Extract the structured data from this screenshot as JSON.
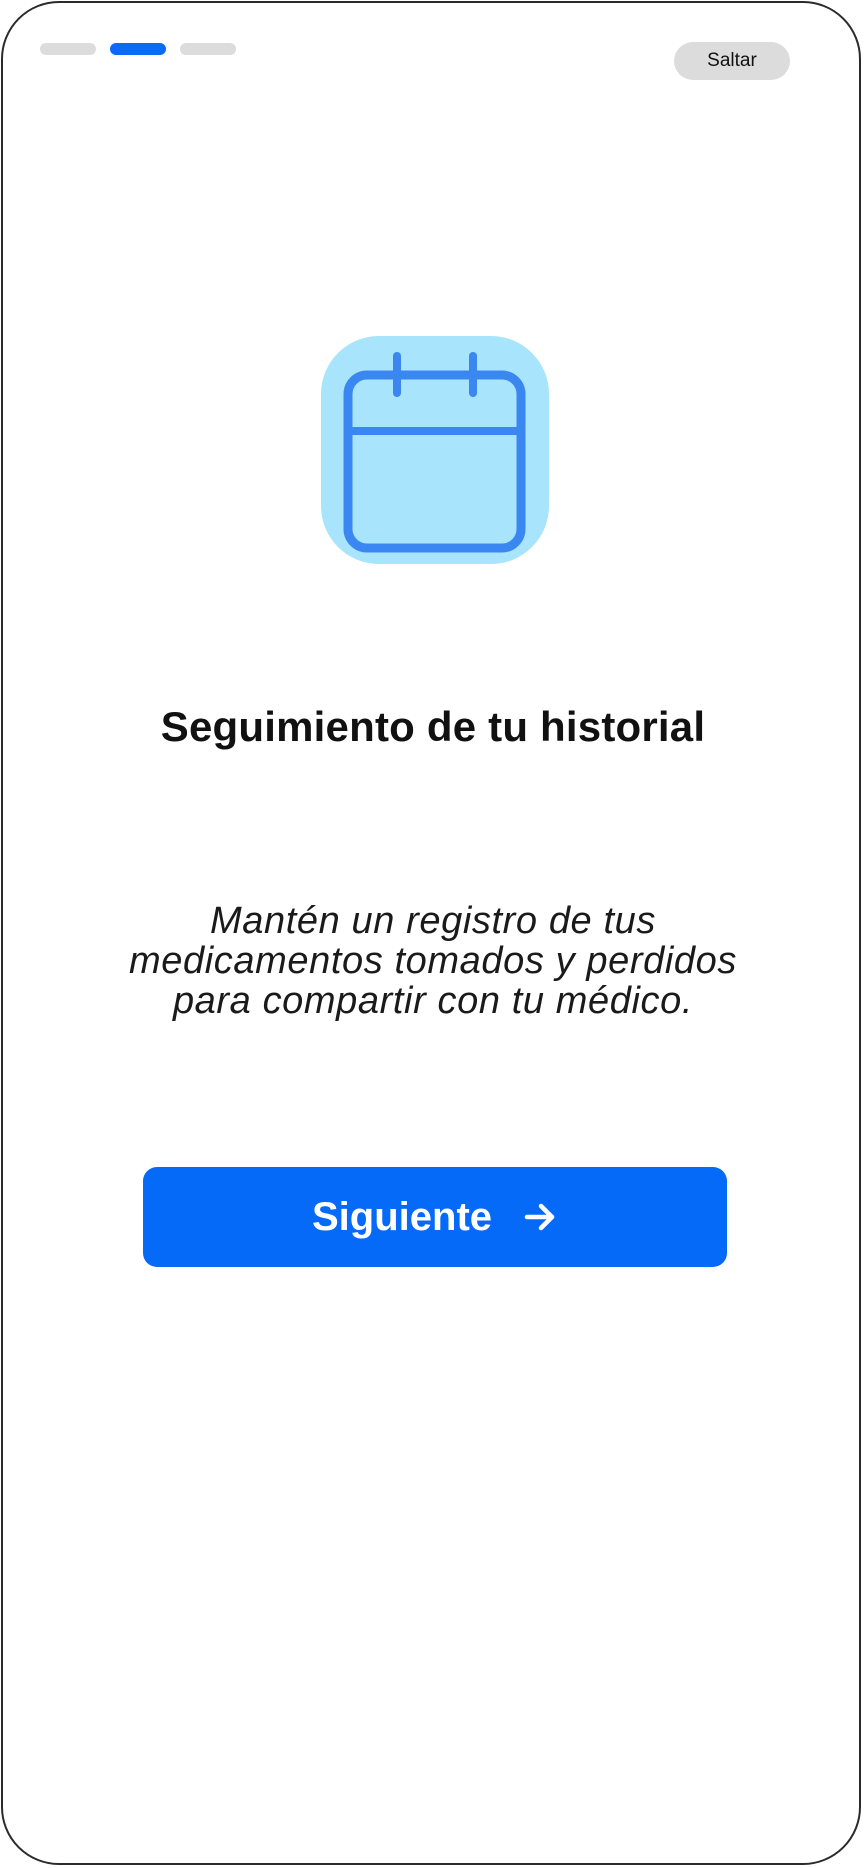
{
  "progress": {
    "total_steps": 3,
    "current_step": 2,
    "active_color": "#0a6cf5",
    "inactive_color": "#dcdcdc"
  },
  "header": {
    "skip_label": "Saltar"
  },
  "illustration": {
    "icon": "calendar-icon",
    "tile_color": "#a8e4fc",
    "stroke_color": "#3b87f2"
  },
  "content": {
    "title": "Seguimiento de tu historial",
    "description_lines": [
      "Mantén un registro de tus",
      "medicamentos tomados y perdidos",
      "para compartir con tu médico."
    ]
  },
  "actions": {
    "next_label": "Siguiente",
    "next_icon": "arrow-right-icon",
    "accent": "#066af9"
  }
}
